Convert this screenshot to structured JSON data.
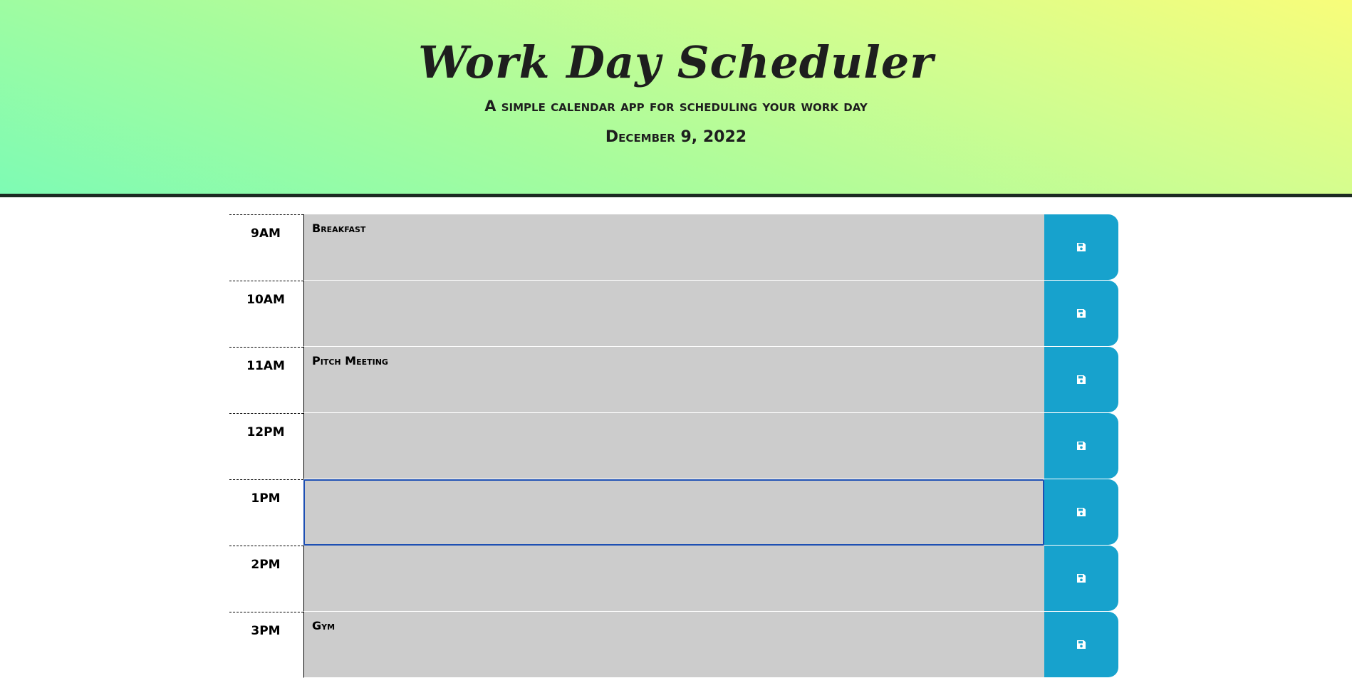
{
  "header": {
    "title": "Work Day Scheduler",
    "subtitle": "A simple calendar app for scheduling your work day",
    "current_day": "December 9, 2022"
  },
  "colors": {
    "gradient": [
      "#f8fd7a",
      "#7efbb4"
    ],
    "header_border": "#1c2a22",
    "time_block_bg": "#cccccc",
    "save_button": "#17a2cd",
    "focus_border": "#1d4fb3"
  },
  "time_blocks": [
    {
      "hour": "9AM",
      "text": "Breakfast",
      "focused": false
    },
    {
      "hour": "10AM",
      "text": "",
      "focused": false
    },
    {
      "hour": "11AM",
      "text": "Pitch Meeting",
      "focused": false
    },
    {
      "hour": "12PM",
      "text": "",
      "focused": false
    },
    {
      "hour": "1PM",
      "text": "",
      "focused": true
    },
    {
      "hour": "2PM",
      "text": "",
      "focused": false
    },
    {
      "hour": "3PM",
      "text": "Gym",
      "focused": false
    }
  ],
  "icons": {
    "save": "floppy-disk-icon"
  }
}
